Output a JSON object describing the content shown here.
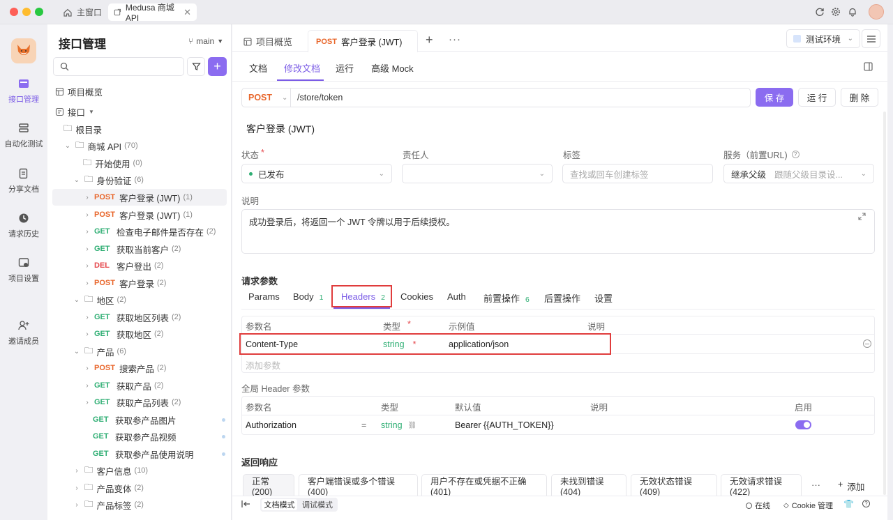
{
  "window": {
    "tabs": [
      {
        "label": "主窗口"
      },
      {
        "label": "Medusa 商城 API"
      }
    ]
  },
  "nav": {
    "items": [
      {
        "label": "接口管理"
      },
      {
        "label": "自动化测试"
      },
      {
        "label": "分享文档"
      },
      {
        "label": "请求历史"
      },
      {
        "label": "项目设置"
      },
      {
        "label": "邀请成员"
      }
    ]
  },
  "sidebar": {
    "title": "接口管理",
    "branch": "main",
    "items": [
      {
        "label": "项目概览"
      },
      {
        "label": "接口"
      },
      {
        "label": "根目录"
      },
      {
        "label": "商城 API",
        "count": "(70)"
      },
      {
        "label": "开始使用",
        "count": "(0)"
      },
      {
        "label": "身份验证",
        "count": "(6)"
      },
      {
        "method": "POST",
        "label": "客户登录 (JWT)",
        "count": "(1)"
      },
      {
        "method": "POST",
        "label": "客户登录 (JWT)",
        "count": "(1)"
      },
      {
        "method": "GET",
        "label": "检查电子邮件是否存在",
        "count": "(2)"
      },
      {
        "method": "GET",
        "label": "获取当前客户",
        "count": "(2)"
      },
      {
        "method": "DEL",
        "label": "客户登出",
        "count": "(2)"
      },
      {
        "method": "POST",
        "label": "客户登录",
        "count": "(2)"
      },
      {
        "label": "地区",
        "count": "(2)"
      },
      {
        "method": "GET",
        "label": "获取地区列表",
        "count": "(2)"
      },
      {
        "method": "GET",
        "label": "获取地区",
        "count": "(2)"
      },
      {
        "label": "产品",
        "count": "(6)"
      },
      {
        "method": "POST",
        "label": "搜索产品",
        "count": "(2)"
      },
      {
        "method": "GET",
        "label": "获取产品",
        "count": "(2)"
      },
      {
        "method": "GET",
        "label": "获取产品列表",
        "count": "(2)"
      },
      {
        "method": "GET",
        "label": "获取参产品图片"
      },
      {
        "method": "GET",
        "label": "获取参产品视频"
      },
      {
        "method": "GET",
        "label": "获取参产品使用说明"
      },
      {
        "label": "客户信息",
        "count": "(10)"
      },
      {
        "label": "产品变体",
        "count": "(2)"
      },
      {
        "label": "产品标签",
        "count": "(2)"
      }
    ]
  },
  "main": {
    "tabs": [
      {
        "label": "项目概览"
      },
      {
        "method": "POST",
        "label": "客户登录 (JWT)"
      }
    ],
    "env": "测试环境",
    "subtabs": [
      "文档",
      "修改文档",
      "运行",
      "高级 Mock"
    ],
    "method": "POST",
    "path": "/store/token",
    "buttons": {
      "save": "保 存",
      "run": "运 行",
      "delete": "删 除"
    },
    "title": "客户登录 (JWT)",
    "fields": {
      "status_label": "状态",
      "status_value": "已发布",
      "owner_label": "责任人",
      "tags_label": "标签",
      "tags_placeholder": "查找或回车创建标签",
      "service_label": "服务（前置URL)",
      "service_value": "继承父级",
      "service_hint": "跟随父级目录设..."
    },
    "desc_label": "说明",
    "desc_text": "成功登录后，将返回一个 JWT 令牌以用于后续授权。",
    "params_title": "请求参数",
    "param_tabs": [
      {
        "label": "Params"
      },
      {
        "label": "Body",
        "count": "1"
      },
      {
        "label": "Headers",
        "count": "2"
      },
      {
        "label": "Cookies"
      },
      {
        "label": "Auth"
      },
      {
        "label": "前置操作",
        "count": "6"
      },
      {
        "label": "后置操作"
      },
      {
        "label": "设置"
      }
    ],
    "headers_table": {
      "cols": [
        "参数名",
        "类型",
        "示例值",
        "说明"
      ],
      "row": {
        "name": "Content-Type",
        "type": "string",
        "example": "application/json"
      },
      "add": "添加参数"
    },
    "global_title": "全局 Header 参数",
    "global_table": {
      "cols": [
        "参数名",
        "类型",
        "默认值",
        "说明",
        "启用"
      ],
      "row": {
        "name": "Authorization",
        "eq": "=",
        "type": "string",
        "default": "Bearer {{AUTH_TOKEN}}"
      }
    },
    "resp_title": "返回响应",
    "resp_tabs": [
      "正常(200)",
      "客户端错误或多个错误(400)",
      "用户不存在或凭据不正确(401)",
      "未找到错误(404)",
      "无效状态错误(409)",
      "无效请求错误(422)"
    ],
    "resp_add": "添加"
  },
  "footer": {
    "modes": [
      "文档模式",
      "调试模式"
    ],
    "online": "在线",
    "cookie": "Cookie 管理"
  },
  "colors": {
    "accent": "#8b6cf0",
    "post": "#e8662b",
    "get": "#2eae73",
    "del": "#e5484d",
    "highlight": "#e03c3c"
  }
}
